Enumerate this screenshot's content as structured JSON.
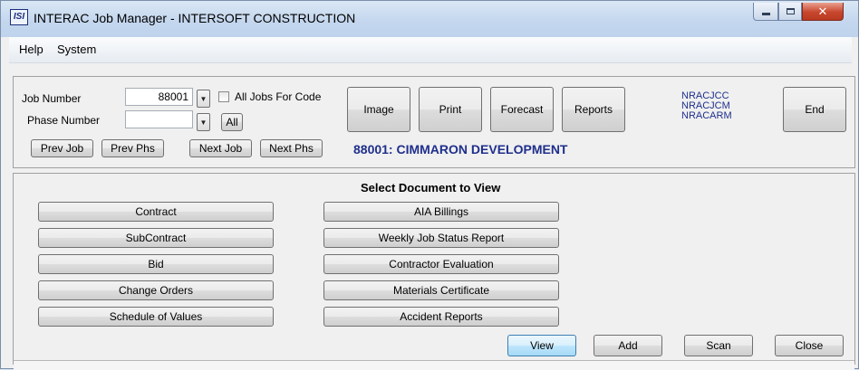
{
  "window": {
    "app_icon_text": "ISI",
    "title": "INTERAC Job Manager - INTERSOFT CONSTRUCTION"
  },
  "menu": [
    "Help",
    "System"
  ],
  "job": {
    "job_number_label": "Job Number",
    "job_number_value": "88001",
    "all_jobs_label": "All Jobs For Code",
    "phase_number_label": "Phase Number",
    "phase_number_value": "",
    "all_button": "All",
    "job_title": "88001: CIMMARON DEVELOPMENT"
  },
  "nav_buttons": {
    "prev_job": "Prev Job",
    "prev_phs": "Prev Phs",
    "next_job": "Next Job",
    "next_phs": "Next Phs"
  },
  "toolbar": {
    "image": "Image",
    "print": "Print",
    "forecast": "Forecast",
    "reports": "Reports",
    "end": "End"
  },
  "codes": [
    "NRACJCC",
    "NRACJCM",
    "NRACARM"
  ],
  "documents": {
    "heading": "Select Document to View",
    "left": [
      "Contract",
      "SubContract",
      "Bid",
      "Change Orders",
      "Schedule of Values"
    ],
    "right": [
      "AIA Billings",
      "Weekly Job Status Report",
      "Contractor Evaluation",
      "Materials Certificate",
      "Accident Reports"
    ]
  },
  "actions": {
    "view": "View",
    "add": "Add",
    "scan": "Scan",
    "close": "Close"
  }
}
